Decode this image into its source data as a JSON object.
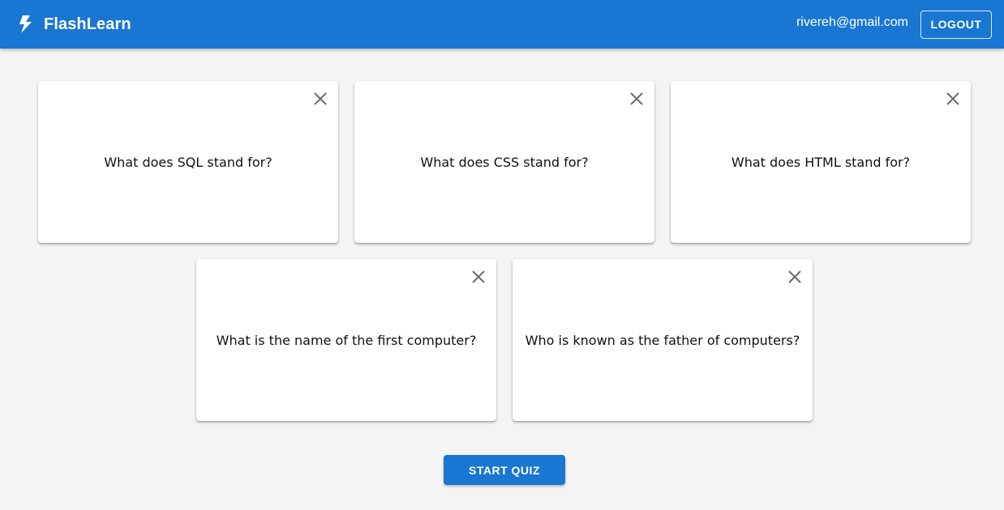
{
  "app": {
    "name": "FlashLearn",
    "logo_icon": "bolt-icon"
  },
  "header": {
    "email": "rivereh@gmail.com",
    "logout_label": "LOGOUT"
  },
  "cards": [
    {
      "question": "What does SQL stand for?"
    },
    {
      "question": "What does CSS stand for?"
    },
    {
      "question": "What does HTML stand for?"
    },
    {
      "question": "What is the name of the first computer?"
    },
    {
      "question": "Who is known as the father of computers?"
    }
  ],
  "actions": {
    "start_quiz_label": "START QUIZ"
  },
  "colors": {
    "primary": "#1976d2",
    "background": "#f4f4f4",
    "card": "#ffffff"
  }
}
